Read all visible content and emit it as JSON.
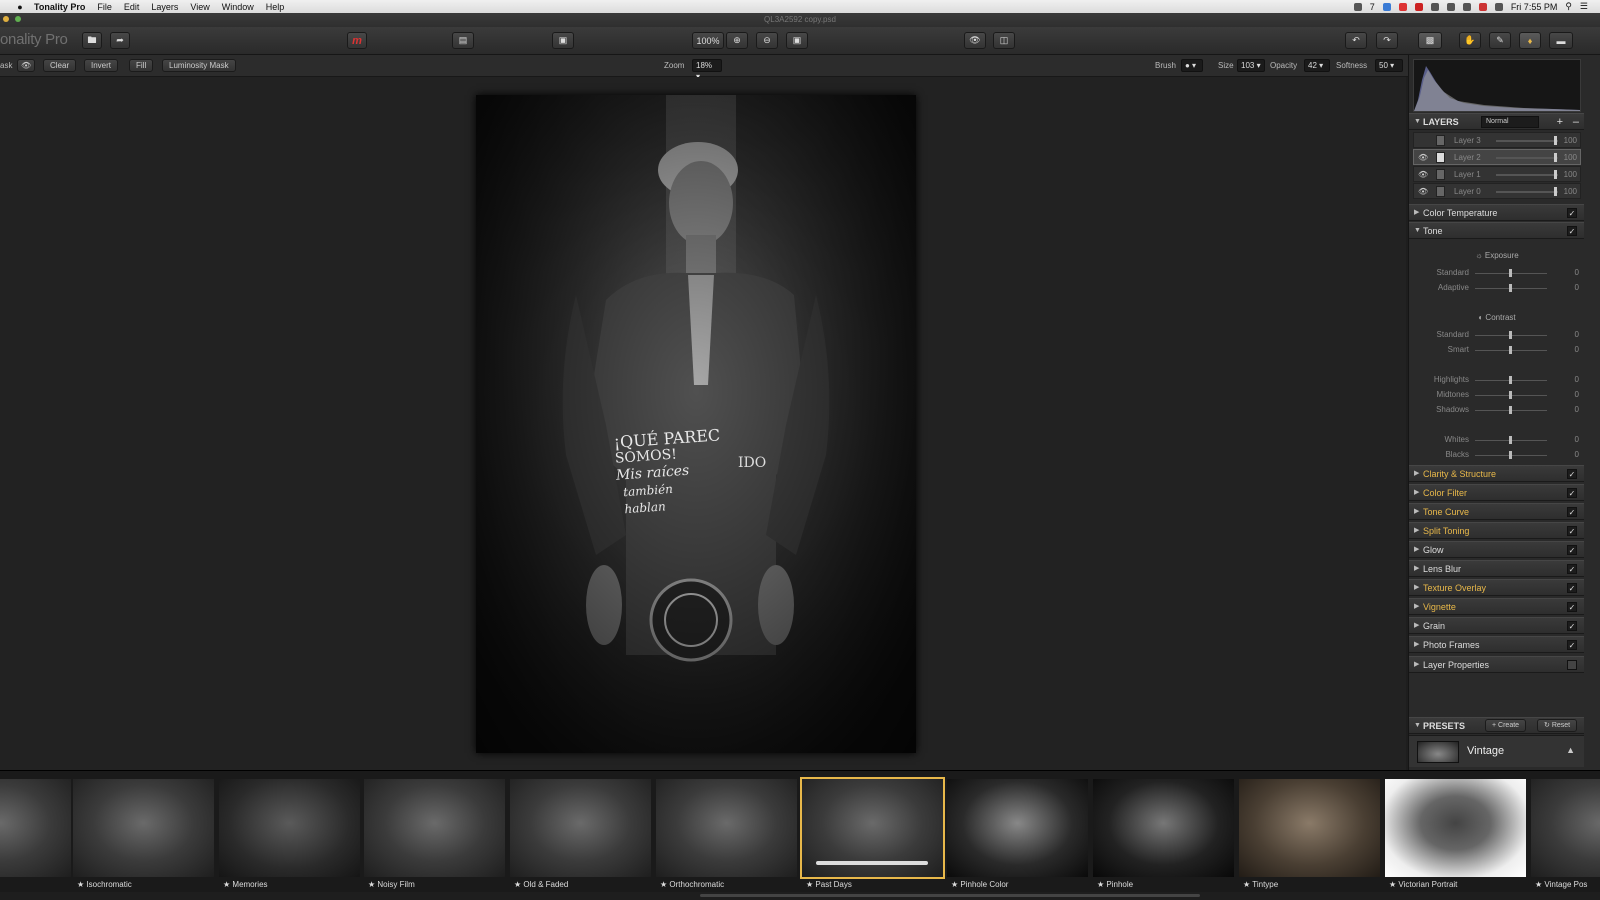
{
  "menubar": {
    "app_name": "Tonality Pro",
    "menus": [
      "File",
      "Edit",
      "Layers",
      "View",
      "Window",
      "Help"
    ],
    "clock": "Fri 7:55 PM",
    "status_num": "7"
  },
  "titlebar": {
    "document": "QL3A2592 copy.psd"
  },
  "toolbar": {
    "logo": "onality Pro",
    "zoom_value": "100%"
  },
  "optbar": {
    "mask_label": "ask",
    "buttons": [
      "Clear",
      "Invert",
      "Fill",
      "Luminosity Mask"
    ],
    "zoom_label": "Zoom",
    "zoom_value": "18%",
    "brush_label": "Brush",
    "size_label": "Size",
    "size_value": "103",
    "opacity_label": "Opacity",
    "opacity_value": "42",
    "softness_label": "Softness",
    "softness_value": "50"
  },
  "photo": {
    "shirt_text_1": "¡QUÉ PAREC",
    "shirt_text_2": "SOMOS!",
    "shirt_text_3": "Mis raíces",
    "shirt_text_4": "también",
    "shirt_text_5": "hablan",
    "shirt_text_6": "IDO"
  },
  "layers": {
    "title": "LAYERS",
    "blend_mode": "Normal",
    "items": [
      {
        "name": "Layer 3",
        "value": "100",
        "visible": false
      },
      {
        "name": "Layer 2",
        "value": "100",
        "visible": true
      },
      {
        "name": "Layer 1",
        "value": "100",
        "visible": true
      },
      {
        "name": "Layer 0",
        "value": "100",
        "visible": true
      }
    ]
  },
  "adjustments": {
    "color_temperature": "Color Temperature",
    "tone": "Tone",
    "exposure": "Exposure",
    "exp_standard": "Standard",
    "exp_adaptive": "Adaptive",
    "contrast": "Contrast",
    "con_standard": "Standard",
    "con_smart": "Smart",
    "highlights": "Highlights",
    "midtones": "Midtones",
    "shadows": "Shadows",
    "whites": "Whites",
    "blacks": "Blacks",
    "zero": "0",
    "sections": [
      {
        "label": "Clarity & Structure",
        "yellow": true
      },
      {
        "label": "Color Filter",
        "yellow": true
      },
      {
        "label": "Tone Curve",
        "yellow": true
      },
      {
        "label": "Split Toning",
        "yellow": true
      },
      {
        "label": "Glow",
        "yellow": false
      },
      {
        "label": "Lens Blur",
        "yellow": false
      },
      {
        "label": "Texture Overlay",
        "yellow": true
      },
      {
        "label": "Vignette",
        "yellow": true
      },
      {
        "label": "Grain",
        "yellow": false
      },
      {
        "label": "Photo Frames",
        "yellow": false
      },
      {
        "label": "Layer Properties",
        "yellow": false
      }
    ]
  },
  "presets": {
    "title": "PRESETS",
    "create": "Create",
    "reset": "Reset",
    "category": "Vintage"
  },
  "filmstrip": [
    "",
    "Isochromatic",
    "Memories",
    "Noisy Film",
    "Old & Faded",
    "Orthochromatic",
    "Past Days",
    "Pinhole Color",
    "Pinhole",
    "Tintype",
    "Victorian Portrait",
    "Vintage Pos"
  ],
  "colors": {
    "accent": "#e8b84a",
    "panel": "#2a2a2a",
    "canvas": "#222222"
  }
}
